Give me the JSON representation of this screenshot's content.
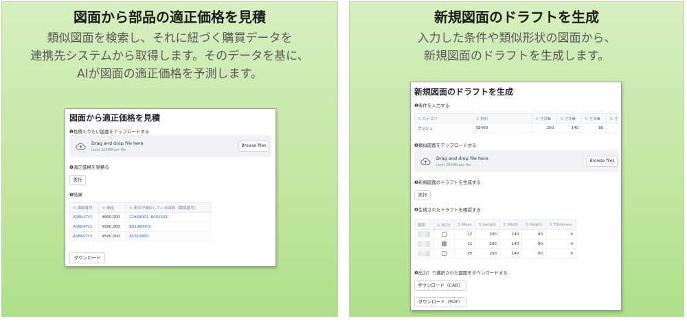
{
  "left_panel": {
    "title": "図面から部品の適正価格を見積",
    "desc_lines": [
      "類似図面を検索し、それに紐づく購買データを",
      "連携先システムから取得します。そのデータを基に、",
      "AIが図面の適正価格を予測します。"
    ],
    "app": {
      "title": "図面から適正価格を見積",
      "step1": "❶見積もりたい図面をアップロードする",
      "upload_main": "Drag and drop file here",
      "upload_limit": "Limit 200MB per file",
      "browse": "Browse files",
      "step2": "❷適正価格を見積る",
      "run": "実行",
      "step3": "❸結果",
      "headers": [
        "図面番号",
        "価格",
        "条件が類似している図面（図面番号）"
      ],
      "rows": [
        [
          "AS8647Y1",
          "¥800,000",
          "12468001, 80013A1"
        ],
        [
          "AS8647Y2",
          "¥900,000",
          "B010WHH1"
        ],
        [
          "AS8647Y3",
          "¥500,000",
          "A53198X0"
        ]
      ],
      "download": "ダウンロード"
    }
  },
  "right_panel": {
    "title": "新規図面のドラフトを生成",
    "desc_lines": [
      "入力した条件や類似形状の図面から、",
      "新規図面のドラフトを生成します。"
    ],
    "app": {
      "title": "新規図面のドラフトを生成",
      "step1": "❶条件を入力する",
      "cond_headers": [
        "カテゴリ",
        "材料",
        "寸法❶",
        "寸法❷",
        "寸法❸",
        "寸"
      ],
      "cond_row": [
        "ブッシュ",
        "SS400",
        "200",
        "140",
        "80",
        ""
      ],
      "step2": "❷類似図面をアップロードする",
      "upload_main": "Drag and drop file here",
      "upload_limit": "Limit 200MB per file",
      "browse": "Browse files",
      "step3": "❸新規図面のドラフトを生成する",
      "run": "実行",
      "step4": "❹生成されたドラフトを確認する",
      "gen_headers": [
        "図面",
        "出力?",
        "Mass",
        "Length",
        "Width",
        "Height",
        "Thickness"
      ],
      "gen_rows": [
        {
          "checked": false,
          "values": [
            "12",
            "200",
            "140",
            "80",
            "4"
          ]
        },
        {
          "checked": true,
          "values": [
            "11",
            "200",
            "140",
            "80",
            "4"
          ]
        },
        {
          "checked": false,
          "values": [
            "25",
            "200",
            "140",
            "80",
            "4"
          ]
        }
      ],
      "step5": "❺出力？で選択された図面をダウンロードする",
      "download_cad": "ダウンロード（CAD）",
      "download_pdf": "ダウンロード（PDF）"
    }
  },
  "colors": {
    "panel_bg": "#c2e6a0",
    "panel_border": "#b9d79a",
    "link": "#1d6fd1"
  },
  "icons": {
    "upload": "cloud-upload-icon",
    "sort": "sort-icon",
    "checkbox": "checkbox-icon",
    "thumbnail": "drawing-thumbnail"
  }
}
